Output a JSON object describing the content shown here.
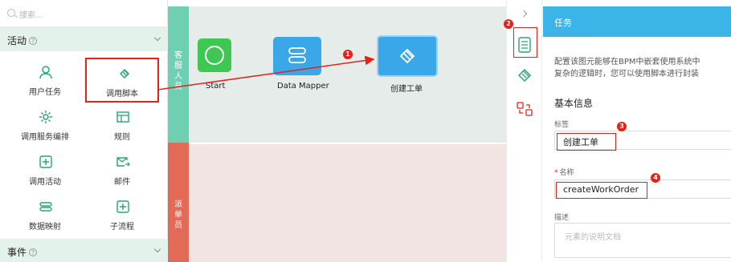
{
  "search": {
    "placeholder": "搜索..."
  },
  "palette": {
    "activities_title": "活动",
    "events_title": "事件",
    "items": [
      {
        "label": "用户任务",
        "icon": "user-icon"
      },
      {
        "label": "调用脚本",
        "icon": "script-icon"
      },
      {
        "label": "调用服务编排",
        "icon": "gear-icon"
      },
      {
        "label": "规则",
        "icon": "table-icon"
      },
      {
        "label": "调用活动",
        "icon": "plus-box-icon"
      },
      {
        "label": "邮件",
        "icon": "mail-icon"
      },
      {
        "label": "数据映射",
        "icon": "data-mapper-icon"
      },
      {
        "label": "子流程",
        "icon": "subprocess-icon"
      }
    ]
  },
  "canvas": {
    "lane1_label": [
      "客",
      "服",
      "人",
      "员"
    ],
    "lane2_label": [
      "派",
      "单",
      "员"
    ],
    "nodes": {
      "start": "Start",
      "mapper": "Data Mapper",
      "ticket": "创建工单"
    }
  },
  "panel": {
    "header": "任务",
    "description_line1": "配置该图元能够在BPM中嵌套使用系统中",
    "description_line2": "复杂的逻辑时，您可以使用脚本进行封装",
    "section_title": "基本信息",
    "label_caption": "标签",
    "label_value": "创建工单",
    "name_caption": "名称",
    "name_required": "*",
    "name_value": "createWorkOrder",
    "desc_caption": "描述",
    "desc_placeholder": "元素的说明文档"
  },
  "callouts": [
    "1",
    "2",
    "3",
    "4"
  ],
  "colors": {
    "accent": "#3bb4e8",
    "start_node": "#3fc753",
    "task_node": "#3aa7e8",
    "lane_customer": "#6fcfb3",
    "lane_dispatcher": "#e26a57",
    "highlight": "#e2231a"
  }
}
